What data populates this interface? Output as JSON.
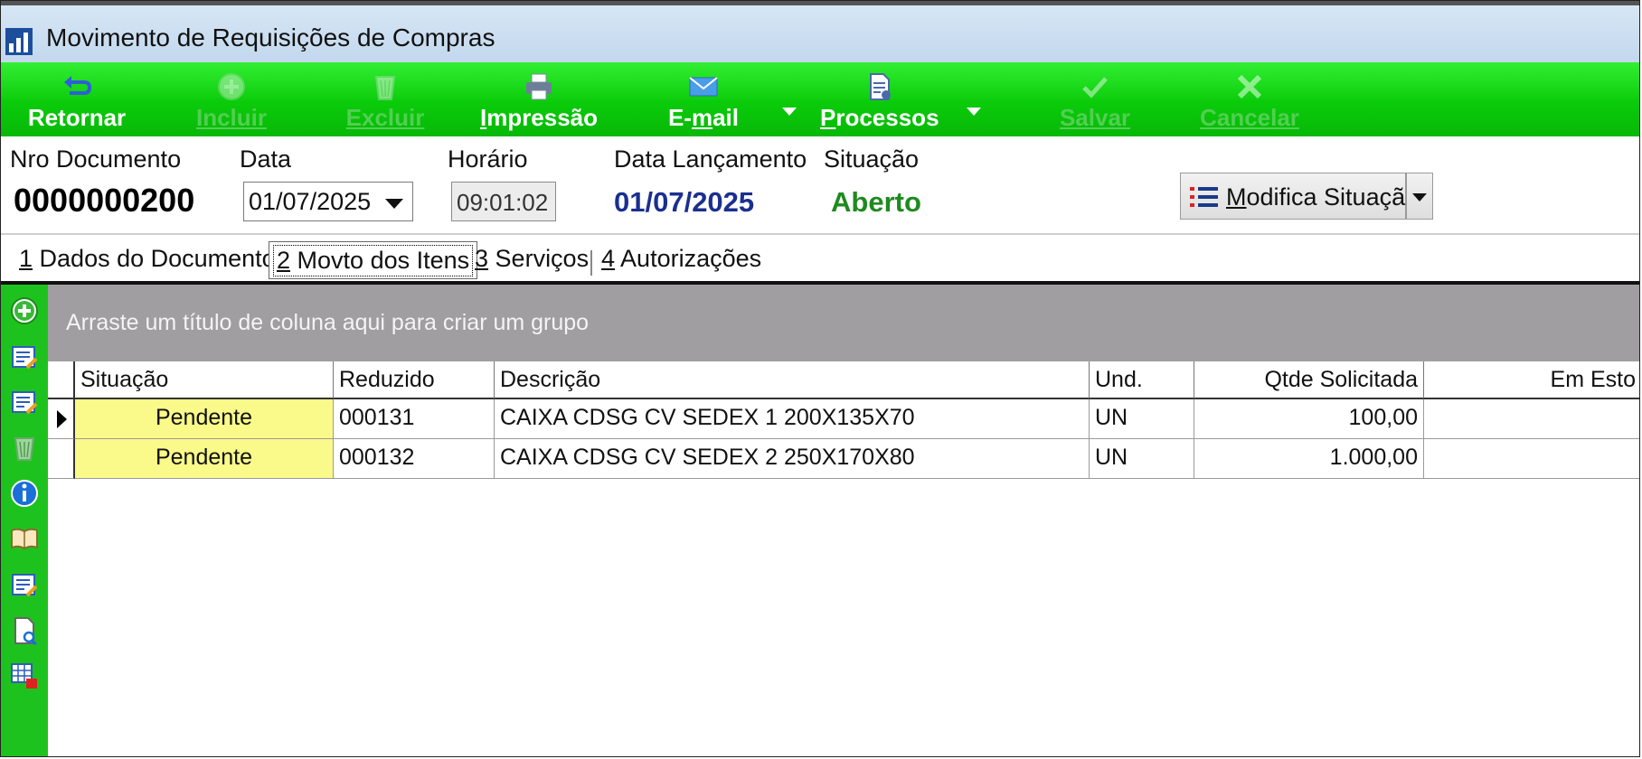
{
  "window": {
    "title": "Movimento de Requisições de Compras"
  },
  "toolbar": {
    "retornar": "Retornar",
    "incluir": "Incluir",
    "excluir": "Excluir",
    "impressao": "Impressão",
    "email": "E-mail",
    "processos": "Processos",
    "salvar": "Salvar",
    "cancelar": "Cancelar"
  },
  "header": {
    "nro_documento_label": "Nro Documento",
    "nro_documento": "0000000200",
    "data_label": "Data",
    "data": "01/07/2025",
    "horario_label": "Horário",
    "horario": "09:01:02",
    "data_lancamento_label": "Data Lançamento",
    "data_lancamento": "01/07/2025",
    "situacao_label": "Situação",
    "situacao": "Aberto",
    "modifica_situacao": "Modifica Situação"
  },
  "tabs": [
    {
      "key": "1",
      "label": "Dados do Documento"
    },
    {
      "key": "2",
      "label": "Movto dos Itens"
    },
    {
      "key": "3",
      "label": "Serviços"
    },
    {
      "key": "4",
      "label": "Autorizações"
    }
  ],
  "grid": {
    "group_hint": "Arraste um título de coluna aqui para criar um grupo",
    "columns": [
      "Situação",
      "Reduzido",
      "Descrição",
      "Und.",
      "Qtde Solicitada",
      "Em Esto"
    ],
    "rows": [
      {
        "situacao": "Pendente",
        "reduzido": "000131",
        "descricao": "CAIXA  CDSG CV SEDEX 1 200X135X70",
        "und": "UN",
        "qtde": "100,00",
        "estoque": ""
      },
      {
        "situacao": "Pendente",
        "reduzido": "000132",
        "descricao": "CAIXA  CDSG CV SEDEX 2 250X170X80",
        "und": "UN",
        "qtde": "1.000,00",
        "estoque": ""
      }
    ]
  },
  "colors": {
    "toolbar": "#0acb0a",
    "sidebar": "#1ec21e",
    "pending_cell": "#fafa8a",
    "status_open": "#1f8a1f",
    "launch_date": "#1a2f8f"
  },
  "icons": {
    "app": "chart-icon",
    "sidebar": [
      "add-icon",
      "edit-icon",
      "edit-icon",
      "trash-icon",
      "info-icon",
      "book-icon",
      "edit-icon",
      "document-search-icon",
      "grid-export-icon"
    ]
  }
}
